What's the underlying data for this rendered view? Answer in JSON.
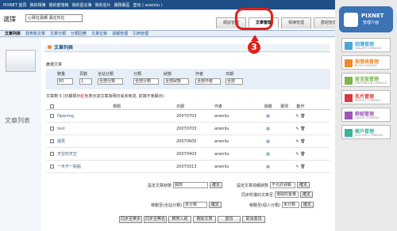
{
  "topbar": {
    "items": [
      "PIXNET 首頁",
      "我的相簿",
      "我的部落格",
      "我的留言簿",
      "我的名片",
      "服務專區",
      "登出 ( anenliu )"
    ]
  },
  "header": {
    "blog_label": "選擇",
    "blog_value": "心驛在異鄉 異在你在"
  },
  "tabs": [
    "網誌管理",
    "文章管理",
    "相簿管理",
    "群組管理"
  ],
  "subnav": [
    "文章列表",
    "發表新文章",
    "文章分類",
    "分類回應",
    "文章位移",
    "週報管理",
    "引用管理"
  ],
  "left": {
    "title": "文章列表"
  },
  "section": {
    "title": "文章列表"
  },
  "filters": {
    "label": "篩選文章",
    "columns": [
      {
        "label": "數量",
        "value": "60"
      },
      {
        "label": "頁數",
        "value": "1"
      },
      {
        "label": "全站分類",
        "value": "全部分類"
      },
      {
        "label": "分類",
        "value": "全部分類"
      },
      {
        "label": "狀態",
        "value": "全部狀態"
      },
      {
        "label": "作者",
        "value": "全部作者"
      },
      {
        "label": "日期",
        "value": "全部"
      }
    ]
  },
  "count": {
    "prefix": "文章數:5 (日期標示",
    "red": "紅色",
    "suffix": "表示該文章為明日尚未到達, 前端不會顯示)"
  },
  "table": {
    "headers": [
      "標題",
      "日期",
      "作者",
      "週報",
      "選項",
      "動作"
    ],
    "rows": [
      {
        "title": "Opening",
        "date": "20070703",
        "author": "anenliu"
      },
      {
        "title": "test",
        "date": "20070703",
        "author": "anenliu"
      },
      {
        "title": "遇見",
        "date": "20070605",
        "author": "anenliu"
      },
      {
        "title": "天空的天空",
        "date": "20070403",
        "author": "anenliu"
      },
      {
        "title": "一天不一點點",
        "date": "20070313",
        "author": "anenliu"
      }
    ]
  },
  "actions": {
    "status_label": "設定文章狀態",
    "status_value": "開放",
    "confirm": "確定",
    "weekly_label": "設定文章週報狀態",
    "weekly_value": "不允許週報",
    "share_label": "同步所選的文章至",
    "share_value": "選取的置量",
    "move_site_label": "移動至(全站分類)",
    "move_site_value": "未分類",
    "move_label": "移動至(個人分類)",
    "move_value": "未分類",
    "buttons": [
      "同步至樂多",
      "同步至無名",
      "轉帶入航",
      "刪除文章",
      "置頂",
      "取消置頂"
    ]
  },
  "logo": {
    "brand": "PIXNET",
    "sub": "管理介面"
  },
  "menu": [
    {
      "label": "相簿管理",
      "sub": "GALLERY CONSOLE",
      "color": "#4aa8d8"
    },
    {
      "label": "部落格管理",
      "sub": "BLOG CONSOLE",
      "color": "#f08a24"
    },
    {
      "label": "留言版管理",
      "sub": "GUESTBOOK CONSOLE",
      "color": "#7ab648"
    },
    {
      "label": "名片管理",
      "sub": "PROFILE CONSOLE",
      "color": "#d63c3c"
    },
    {
      "label": "群組管理",
      "sub": "GROUP CONSOLE",
      "color": "#9b59b6"
    },
    {
      "label": "帳戶管理",
      "sub": "ACCOUNT CONSOLE",
      "color": "#3bb39b"
    }
  ],
  "annotation": {
    "number": "3"
  }
}
